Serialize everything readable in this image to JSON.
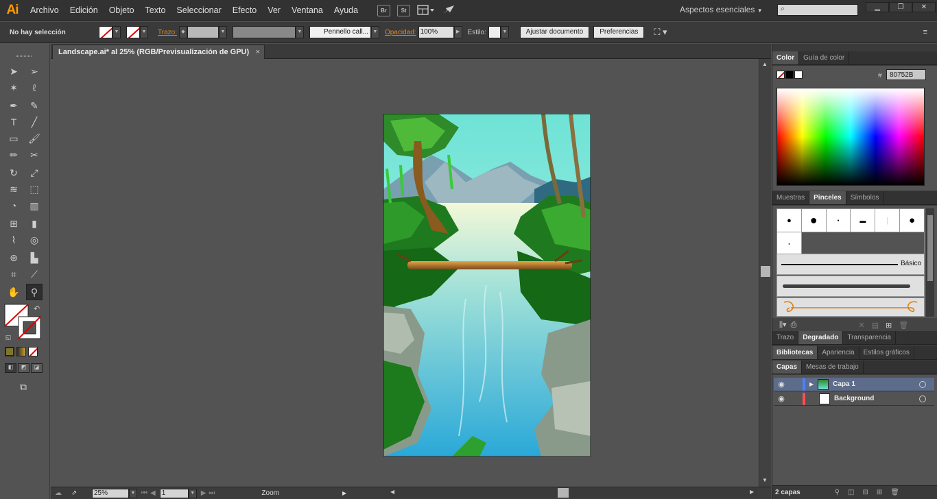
{
  "app": {
    "logo": "Ai"
  },
  "menu": [
    "Archivo",
    "Edición",
    "Objeto",
    "Texto",
    "Seleccionar",
    "Efecto",
    "Ver",
    "Ventana",
    "Ayuda"
  ],
  "menubar_icons": {
    "br": "Br",
    "st": "St"
  },
  "workspace": "Aspectos esenciales",
  "window_controls": {
    "minimize": "▁",
    "restore": "❐",
    "close": "✕"
  },
  "control": {
    "selection": "No hay selección",
    "stroke_label": "Trazo:",
    "brush": "Pennello call...",
    "opacity_label": "Opacidad:",
    "opacity_value": "100%",
    "style_label": "Estilo:",
    "adjust_doc": "Ajustar documento",
    "preferences": "Preferencias"
  },
  "document": {
    "tab_title": "Landscape.ai* al 25% (RGB/Previsualización de GPU)",
    "close": "×"
  },
  "status": {
    "zoom": "25%",
    "page": "1",
    "label": "Zoom"
  },
  "panels": {
    "color_tabs": [
      "Color",
      "Guía de color"
    ],
    "hex_label": "#",
    "hex_value": "80752B",
    "brush_tabs": [
      "Muestras",
      "Pinceles",
      "Símbolos"
    ],
    "basic_label": "Básico",
    "gradient_tabs": [
      "Trazo",
      "Degradado",
      "Transparencia"
    ],
    "lib_tabs": [
      "Bibliotecas",
      "Apariencia",
      "Estilos gráficos"
    ],
    "layer_tabs": [
      "Capas",
      "Mesas de trabajo"
    ],
    "layers": [
      {
        "name": "Capa 1",
        "color": "#4f7fff"
      },
      {
        "name": "Background",
        "color": "#ff4f4f"
      }
    ],
    "layers_count": "2 capas"
  },
  "colors": {
    "accent": "#e08a1e",
    "selected_layer": "#5c6c8a"
  }
}
